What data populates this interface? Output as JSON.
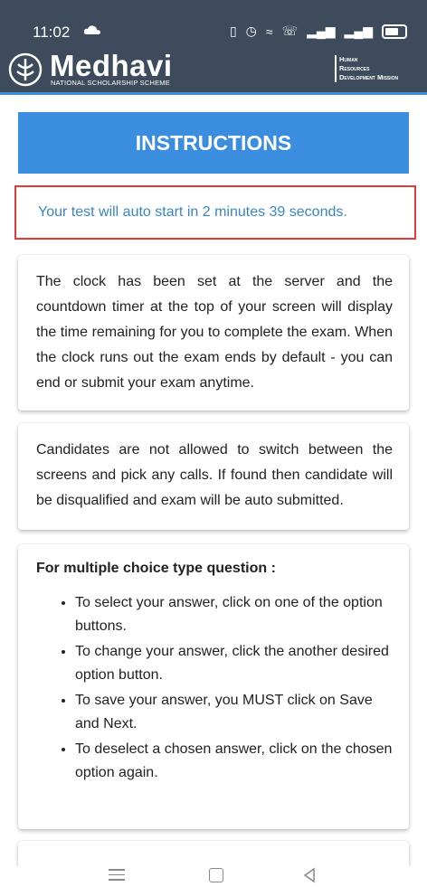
{
  "statusbar": {
    "time": "11:02"
  },
  "header": {
    "brand": "Medhavi",
    "tagline": "NATIONAL SCHOLARSHIP SCHEME",
    "org_line1": "Human",
    "org_line2": "Resources",
    "org_line3": "Development Mission"
  },
  "instructions": {
    "title": "INSTRUCTIONS"
  },
  "countdown": {
    "message": "Your test will auto start in 2 minutes 39 seconds."
  },
  "cards": {
    "clock": "The clock has been set at the server and the countdown timer at the top of your screen will display the time remaining for you to complete the exam. When the clock runs out the exam ends by default - you can end or submit your exam anytime.",
    "switching": "Candidates are not allowed to switch between the screens and pick any calls. If found then candidate will be disqualified and exam will be auto submitted.",
    "mcq_title": "For multiple choice type question :",
    "mcq_items": [
      "To select your answer, click on one of the option buttons.",
      "To change your answer, click the another desired option button.",
      "To save your answer, you MUST click on Save and Next.",
      "To deselect a chosen answer, click on the chosen option again."
    ]
  }
}
